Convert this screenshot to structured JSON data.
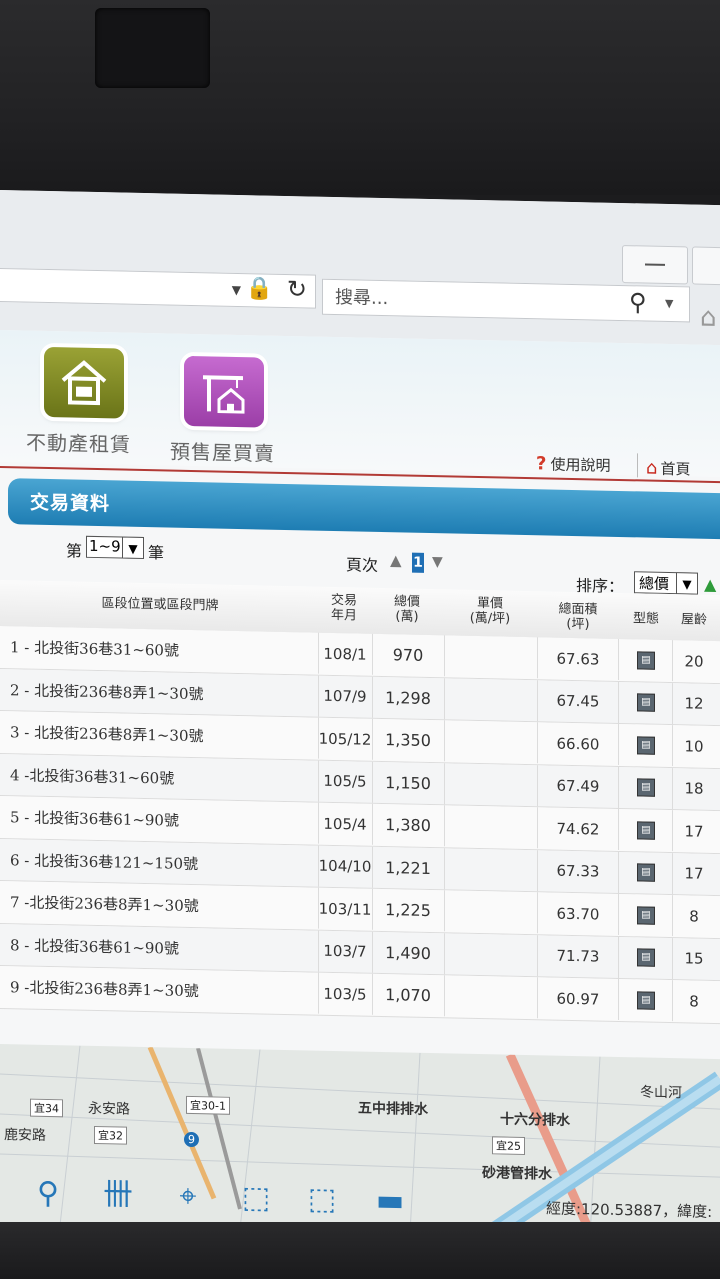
{
  "browser": {
    "search_placeholder": "搜尋..."
  },
  "header": {
    "rent_label": "不動產租賃",
    "presale_label": "預售屋買賣",
    "help_label": "使用說明",
    "home_label": "首頁"
  },
  "section": {
    "title": "交易資料"
  },
  "pager": {
    "prefix": "第",
    "range": "1~9",
    "suffix": "筆",
    "page_label": "頁次",
    "current_page": "1",
    "sort_label": "排序：",
    "sort_value": "總價"
  },
  "table": {
    "headers": {
      "address": "區段位置或區段門牌",
      "date_l1": "交易",
      "date_l2": "年月",
      "price_l1": "總價",
      "price_l2": "(萬)",
      "unit_l1": "單價",
      "unit_l2": "(萬/坪)",
      "area_l1": "總面積",
      "area_l2": "(坪)",
      "type": "型態",
      "age": "屋齡"
    },
    "rows": [
      {
        "addr": "1 - 北投街36巷31~60號",
        "date": "108/1",
        "price": "970",
        "area": "67.63",
        "age": "20"
      },
      {
        "addr": "2 - 北投街236巷8弄1~30號",
        "date": "107/9",
        "price": "1,298",
        "area": "67.45",
        "age": "12"
      },
      {
        "addr": "3 - 北投街236巷8弄1~30號",
        "date": "105/12",
        "price": "1,350",
        "area": "66.60",
        "age": "10"
      },
      {
        "addr": "4 -北投街36巷31~60號",
        "date": "105/5",
        "price": "1,150",
        "area": "67.49",
        "age": "18"
      },
      {
        "addr": "5 - 北投街36巷61~90號",
        "date": "105/4",
        "price": "1,380",
        "area": "74.62",
        "age": "17"
      },
      {
        "addr": "6 - 北投街36巷121~150號",
        "date": "104/10",
        "price": "1,221",
        "area": "67.33",
        "age": "17"
      },
      {
        "addr": "7 -北投街236巷8弄1~30號",
        "date": "103/11",
        "price": "1,225",
        "area": "63.70",
        "age": "8"
      },
      {
        "addr": "8 - 北投街36巷61~90號",
        "date": "103/7",
        "price": "1,490",
        "area": "71.73",
        "age": "15"
      },
      {
        "addr": "9 -北投街236巷8弄1~30號",
        "date": "103/5",
        "price": "1,070",
        "area": "60.97",
        "age": "8"
      }
    ]
  },
  "map": {
    "labels": [
      "五中排排水",
      "十六分排水",
      "砂港管排水",
      "永安路",
      "鹿安路",
      "冬山河"
    ],
    "chips": [
      "宜34",
      "宜30-1",
      "宜32",
      "宜25"
    ],
    "route_badge": "9",
    "coords": "經度:120.53887，緯度:"
  }
}
